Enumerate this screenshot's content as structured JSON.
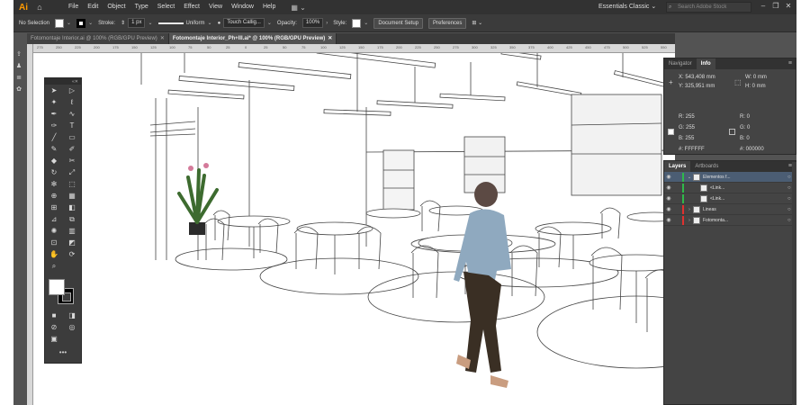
{
  "menubar": {
    "logo": "Ai",
    "menus": [
      "File",
      "Edit",
      "Object",
      "Type",
      "Select",
      "Effect",
      "View",
      "Window",
      "Help"
    ],
    "workspace": "Essentials Classic",
    "workspace_arrow": "⌄",
    "search_placeholder": "Search Adobe Stock"
  },
  "controlbar": {
    "selection": "No Selection",
    "stroke_label": "Stroke:",
    "stroke_value": "1 px",
    "stroke_style": "Uniform",
    "brush": "Touch Callig...",
    "opacity_label": "Opacity:",
    "opacity_value": "100%",
    "style_label": "Style:",
    "doc_setup": "Document Setup",
    "preferences": "Preferences"
  },
  "tabs": [
    {
      "label": "Fotomontaje Interior.ai @ 100% (RGB/GPU Preview)",
      "close": "✕"
    },
    {
      "label": "Fotomontaje Interior_Ph+Ill.ai* @ 100% (RGB/GPU Preview)",
      "close": "✕"
    }
  ],
  "ruler_ticks": [
    "275",
    "250",
    "225",
    "200",
    "175",
    "150",
    "125",
    "100",
    "75",
    "50",
    "25",
    "0",
    "25",
    "50",
    "75",
    "100",
    "125",
    "150",
    "175",
    "200",
    "225",
    "250",
    "275",
    "300",
    "325",
    "350",
    "375",
    "400",
    "425",
    "450",
    "475",
    "500",
    "525",
    "550"
  ],
  "navigator_panel": {
    "tabs": [
      "Navigator",
      "Info"
    ],
    "x_label": "X:",
    "x_value": "543,408 mm",
    "y_label": "Y:",
    "y_value": "325,951 mm",
    "w_label": "W:",
    "w_value": "0 mm",
    "h_label": "H:",
    "h_value": "0 mm",
    "r1": "R: 255",
    "g1": "G: 255",
    "b1": "B: 255",
    "hex1": "#: FFFFFF",
    "r2": "R: 0",
    "g2": "G: 0",
    "b2": "B: 0",
    "hex2": "#: 000000"
  },
  "layers_panel": {
    "tabs": [
      "Layers",
      "Artboards"
    ],
    "rows": [
      {
        "name": "Elementos f...",
        "color": "#2fb84a",
        "twirl": "⌄",
        "selected": true
      },
      {
        "name": "<Link...",
        "color": "#2fb84a",
        "twirl": "",
        "selected": false
      },
      {
        "name": "<Link...",
        "color": "#2fb84a",
        "twirl": "",
        "selected": false
      },
      {
        "name": "Lineas",
        "color": "#e0312f",
        "twirl": "›",
        "selected": false
      },
      {
        "name": "Fotomonta...",
        "color": "#e0312f",
        "twirl": "›",
        "selected": false
      }
    ]
  },
  "colors": {
    "app_bg": "#535353",
    "menubar_bg": "#323232",
    "accent_logo": "#ff9a00",
    "layer_selection": "#4b5d73"
  }
}
